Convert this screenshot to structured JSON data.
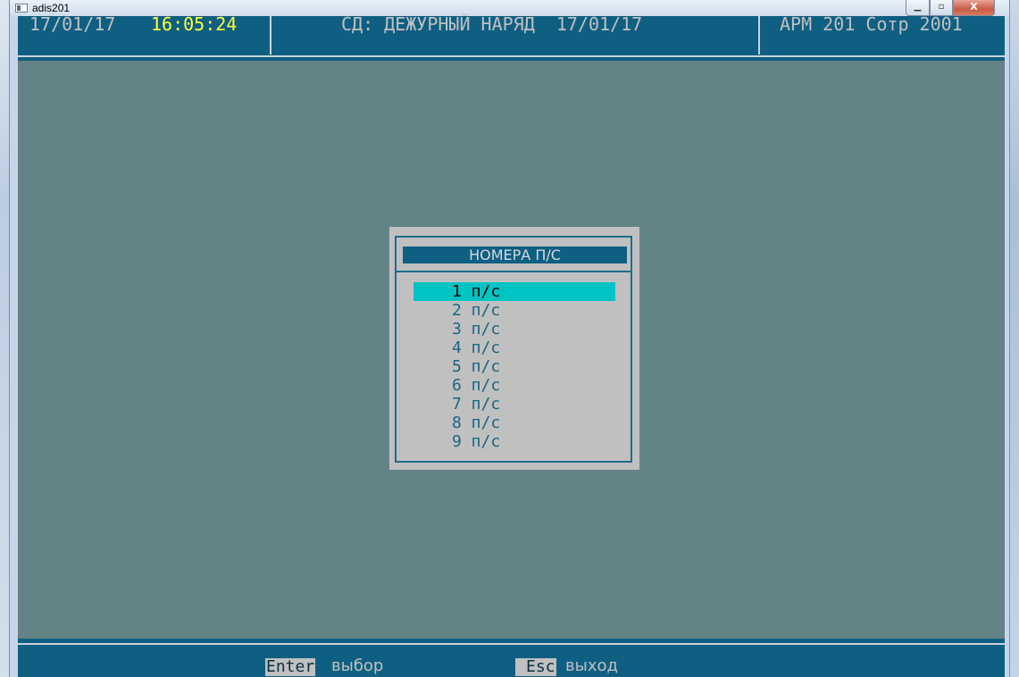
{
  "window": {
    "title": "adis201",
    "buttons": {
      "minimize": "▁",
      "maximize": "▫",
      "close": "X"
    }
  },
  "header": {
    "date": "17/01/17",
    "time": "16:05:24",
    "center_label": "СД: ДЕЖУРНЫЙ НАРЯД  17/01/17",
    "right_label": "АРМ 201 Сотр 2001"
  },
  "dialog": {
    "title": "НОМЕРА П/С",
    "items": [
      {
        "label": "1 п/с"
      },
      {
        "label": "2 п/с"
      },
      {
        "label": "3 п/с"
      },
      {
        "label": "4 п/с"
      },
      {
        "label": "5 п/с"
      },
      {
        "label": "6 п/с"
      },
      {
        "label": "7 п/с"
      },
      {
        "label": "8 п/с"
      },
      {
        "label": "9 п/с"
      }
    ],
    "selected_index": 0
  },
  "footer": {
    "enter_key": "Enter",
    "enter_desc": "выбор",
    "esc_key": "Esc",
    "esc_desc": "выход"
  },
  "colors": {
    "console_bg": "#648387",
    "bar_bg": "#0f5f82",
    "dialog_bg": "#c0c0c0",
    "selection": "#00c4c4",
    "clock": "#ffff3c"
  }
}
